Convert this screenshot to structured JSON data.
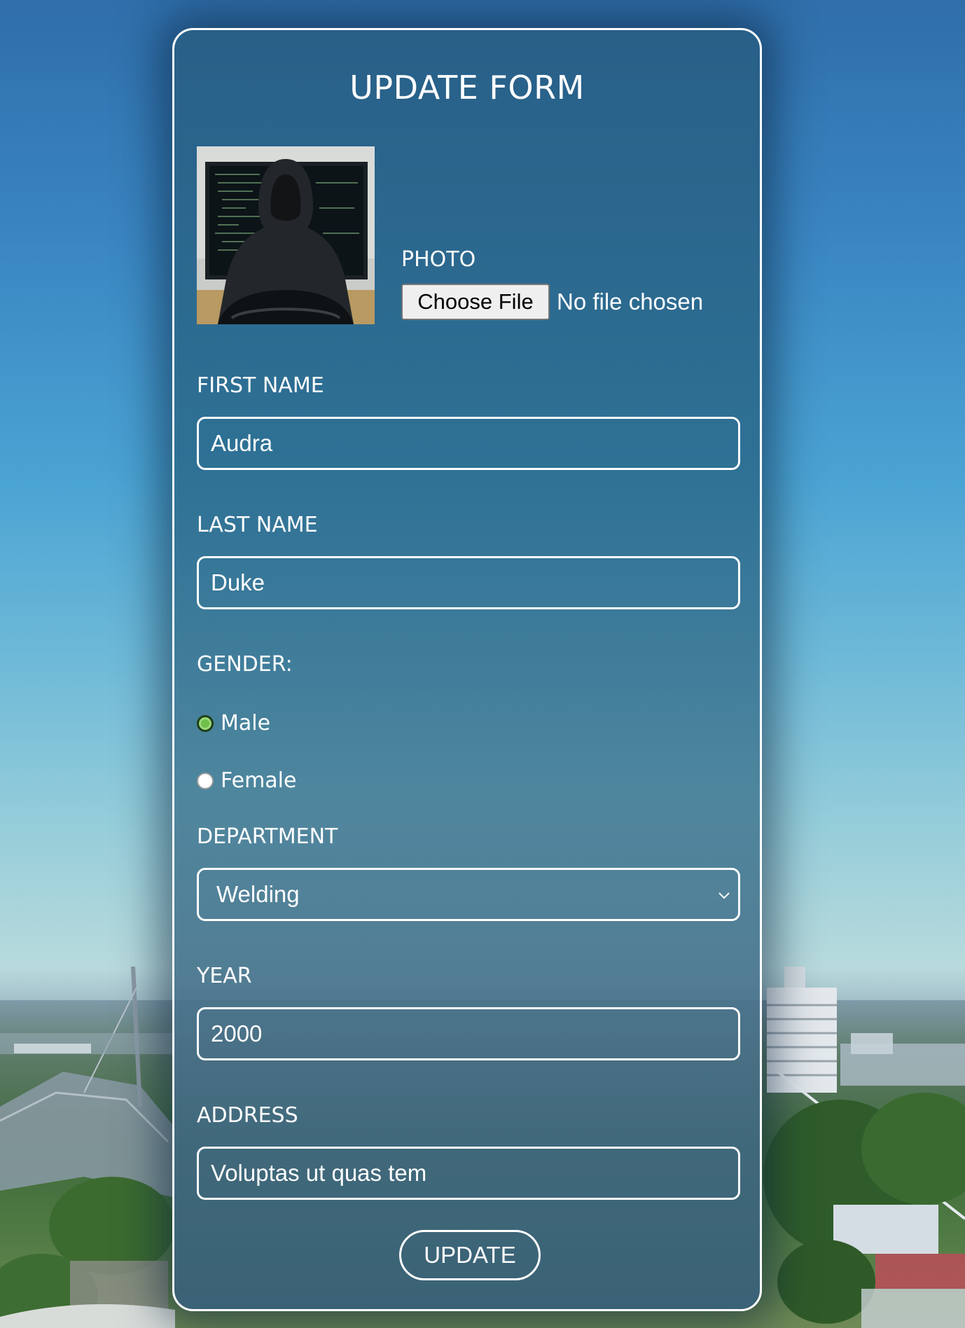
{
  "form": {
    "title": "UPDATE FORM",
    "photo": {
      "label": "PHOTO",
      "choose_button": "Choose File",
      "file_status": "No file chosen"
    },
    "first_name": {
      "label": "FIRST NAME",
      "value": "Audra"
    },
    "last_name": {
      "label": "LAST NAME",
      "value": "Duke"
    },
    "gender": {
      "label": "GENDER:",
      "options": [
        {
          "label": "Male",
          "checked": true
        },
        {
          "label": "Female",
          "checked": false
        }
      ]
    },
    "department": {
      "label": "DEPARTMENT",
      "selected": "Welding"
    },
    "year": {
      "label": "YEAR",
      "value": "2000"
    },
    "address": {
      "label": "ADDRESS",
      "value": "Voluptas ut quas tem"
    },
    "submit_label": "UPDATE"
  },
  "colors": {
    "card_border": "#ffffff",
    "text": "#ffffff",
    "radio_checked": "#6fbf4a"
  },
  "icons": [
    "chevron-down-icon",
    "radio-checked-icon",
    "radio-unchecked-icon"
  ]
}
